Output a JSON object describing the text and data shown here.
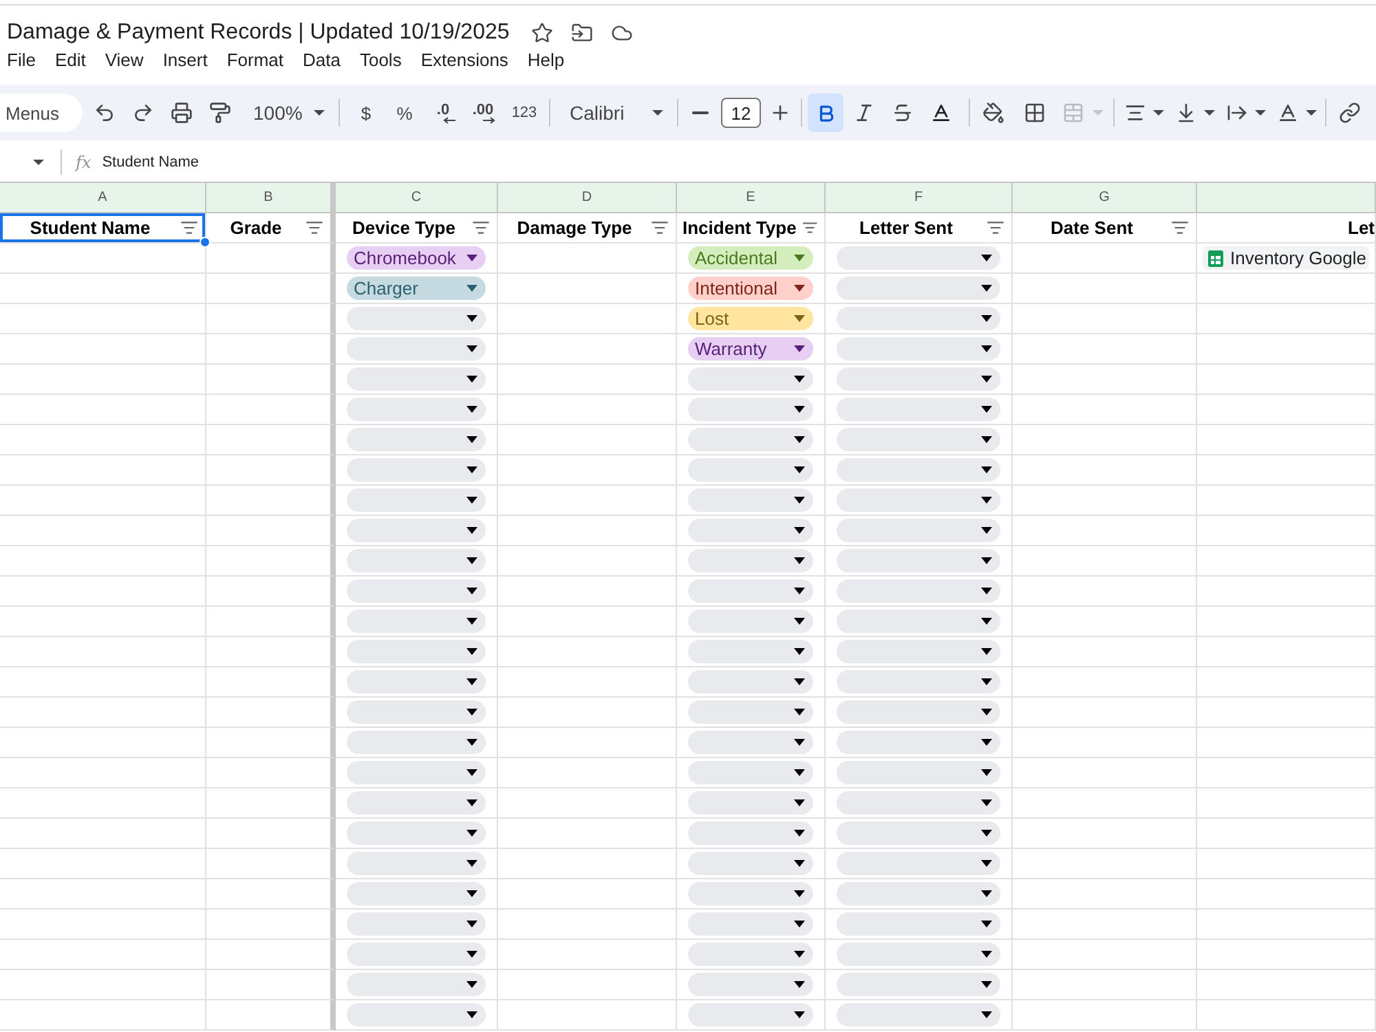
{
  "document": {
    "title": "Damage & Payment Records | Updated 10/19/2025"
  },
  "menu": [
    "File",
    "Edit",
    "View",
    "Insert",
    "Format",
    "Data",
    "Tools",
    "Extensions",
    "Help"
  ],
  "toolbar": {
    "menus_button": "Menus",
    "zoom": "100%",
    "currency": "$",
    "percent": "%",
    "decrease_decimals": ".0",
    "increase_decimals": ".00",
    "number_format": "123",
    "font": "Calibri",
    "font_size": "12",
    "bold": true,
    "italic": false,
    "strikethrough": false,
    "merge_disabled": true
  },
  "formula_bar": {
    "function_symbol": "fx",
    "value": "Student Name"
  },
  "columns": [
    {
      "letter": "A",
      "title": "Student Name",
      "filter": true,
      "frozen": true,
      "selected": true
    },
    {
      "letter": "B",
      "title": "Grade",
      "filter": true,
      "frozen": true,
      "selected": false
    },
    {
      "letter": "C",
      "title": "Device Type",
      "filter": true,
      "frozen": false,
      "selected": false
    },
    {
      "letter": "D",
      "title": "Damage Type",
      "filter": true,
      "frozen": false,
      "selected": false
    },
    {
      "letter": "E",
      "title": "Incident Type",
      "filter": true,
      "frozen": false,
      "selected": false
    },
    {
      "letter": "F",
      "title": "Letter Sent",
      "filter": true,
      "frozen": false,
      "selected": false
    },
    {
      "letter": "G",
      "title": "Date Sent",
      "filter": true,
      "frozen": false,
      "selected": false
    },
    {
      "title": "Let",
      "filter": false,
      "frozen": false,
      "selected": false
    }
  ],
  "rows": [
    {
      "device_type": {
        "kind": "dropdown",
        "value": "Chromebook",
        "color": "#e6cff2"
      },
      "incident_type": {
        "kind": "dropdown",
        "value": "Accidental",
        "color": "#d4edbc"
      },
      "letter_sent": {
        "kind": "dropdown"
      },
      "column_8": {
        "kind": "file",
        "value": "Inventory Google"
      }
    },
    {
      "device_type": {
        "kind": "dropdown",
        "value": "Charger",
        "color": "#c6dbe1"
      },
      "incident_type": {
        "kind": "dropdown",
        "value": "Intentional",
        "color": "#ffcfc9"
      },
      "letter_sent": {
        "kind": "dropdown"
      }
    },
    {
      "device_type": {
        "kind": "dropdown"
      },
      "incident_type": {
        "kind": "dropdown",
        "value": "Lost",
        "color": "#ffe5a0"
      },
      "letter_sent": {
        "kind": "dropdown"
      }
    },
    {
      "device_type": {
        "kind": "dropdown"
      },
      "incident_type": {
        "kind": "dropdown",
        "value": "Warranty",
        "color": "#e6cff2"
      },
      "letter_sent": {
        "kind": "dropdown"
      }
    },
    {
      "device_type": {
        "kind": "dropdown"
      },
      "incident_type": {
        "kind": "dropdown"
      },
      "letter_sent": {
        "kind": "dropdown"
      }
    },
    {
      "device_type": {
        "kind": "dropdown"
      },
      "incident_type": {
        "kind": "dropdown"
      },
      "letter_sent": {
        "kind": "dropdown"
      }
    },
    {
      "device_type": {
        "kind": "dropdown"
      },
      "incident_type": {
        "kind": "dropdown"
      },
      "letter_sent": {
        "kind": "dropdown"
      }
    },
    {
      "device_type": {
        "kind": "dropdown"
      },
      "incident_type": {
        "kind": "dropdown"
      },
      "letter_sent": {
        "kind": "dropdown"
      }
    },
    {
      "device_type": {
        "kind": "dropdown"
      },
      "incident_type": {
        "kind": "dropdown"
      },
      "letter_sent": {
        "kind": "dropdown"
      }
    },
    {
      "device_type": {
        "kind": "dropdown"
      },
      "incident_type": {
        "kind": "dropdown"
      },
      "letter_sent": {
        "kind": "dropdown"
      }
    },
    {
      "device_type": {
        "kind": "dropdown"
      },
      "incident_type": {
        "kind": "dropdown"
      },
      "letter_sent": {
        "kind": "dropdown"
      }
    },
    {
      "device_type": {
        "kind": "dropdown"
      },
      "incident_type": {
        "kind": "dropdown"
      },
      "letter_sent": {
        "kind": "dropdown"
      }
    },
    {
      "device_type": {
        "kind": "dropdown"
      },
      "incident_type": {
        "kind": "dropdown"
      },
      "letter_sent": {
        "kind": "dropdown"
      }
    },
    {
      "device_type": {
        "kind": "dropdown"
      },
      "incident_type": {
        "kind": "dropdown"
      },
      "letter_sent": {
        "kind": "dropdown"
      }
    },
    {
      "device_type": {
        "kind": "dropdown"
      },
      "incident_type": {
        "kind": "dropdown"
      },
      "letter_sent": {
        "kind": "dropdown"
      }
    },
    {
      "device_type": {
        "kind": "dropdown"
      },
      "incident_type": {
        "kind": "dropdown"
      },
      "letter_sent": {
        "kind": "dropdown"
      }
    },
    {
      "device_type": {
        "kind": "dropdown"
      },
      "incident_type": {
        "kind": "dropdown"
      },
      "letter_sent": {
        "kind": "dropdown"
      }
    },
    {
      "device_type": {
        "kind": "dropdown"
      },
      "incident_type": {
        "kind": "dropdown"
      },
      "letter_sent": {
        "kind": "dropdown"
      }
    },
    {
      "device_type": {
        "kind": "dropdown"
      },
      "incident_type": {
        "kind": "dropdown"
      },
      "letter_sent": {
        "kind": "dropdown"
      }
    },
    {
      "device_type": {
        "kind": "dropdown"
      },
      "incident_type": {
        "kind": "dropdown"
      },
      "letter_sent": {
        "kind": "dropdown"
      }
    },
    {
      "device_type": {
        "kind": "dropdown"
      },
      "incident_type": {
        "kind": "dropdown"
      },
      "letter_sent": {
        "kind": "dropdown"
      }
    },
    {
      "device_type": {
        "kind": "dropdown"
      },
      "incident_type": {
        "kind": "dropdown"
      },
      "letter_sent": {
        "kind": "dropdown"
      }
    },
    {
      "device_type": {
        "kind": "dropdown"
      },
      "incident_type": {
        "kind": "dropdown"
      },
      "letter_sent": {
        "kind": "dropdown"
      }
    },
    {
      "device_type": {
        "kind": "dropdown"
      },
      "incident_type": {
        "kind": "dropdown"
      },
      "letter_sent": {
        "kind": "dropdown"
      }
    },
    {
      "device_type": {
        "kind": "dropdown"
      },
      "incident_type": {
        "kind": "dropdown"
      },
      "letter_sent": {
        "kind": "dropdown"
      }
    },
    {
      "device_type": {
        "kind": "dropdown"
      },
      "incident_type": {
        "kind": "dropdown"
      },
      "letter_sent": {
        "kind": "dropdown"
      }
    }
  ]
}
